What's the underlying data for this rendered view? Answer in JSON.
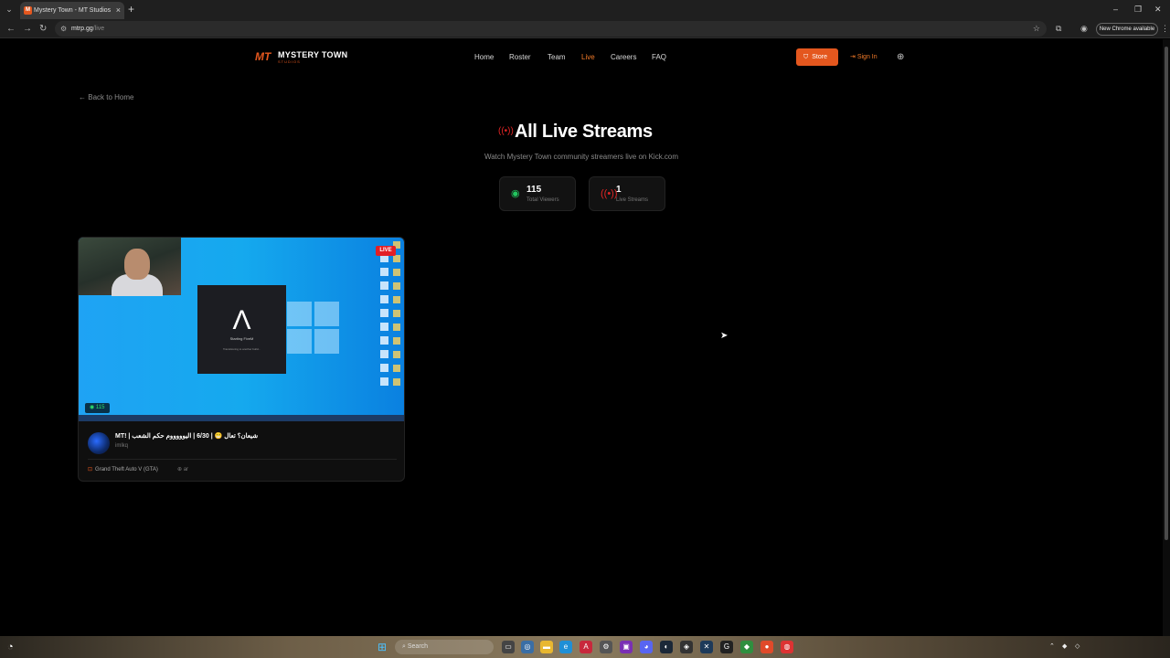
{
  "browser": {
    "tab_title": "Mystery Town - MT Studios | M",
    "favicon_text": "M",
    "url_host": "mtrp.gg",
    "url_path": "/live",
    "update_label": "New Chrome available"
  },
  "site": {
    "logo_mark": "MT",
    "logo_name": "MYSTERY TOWN",
    "logo_sub": "STUDIOS",
    "nav": [
      "Home",
      "Roster",
      "Team",
      "Live",
      "Careers",
      "FAQ"
    ],
    "active_nav": "Live",
    "store_label": "Store",
    "signin_label": "Sign In",
    "accent": "#e4571e"
  },
  "page": {
    "back_label": "Back to Home",
    "title": "All Live Streams",
    "subtitle": "Watch Mystery Town community streamers live on Kick.com",
    "stats": [
      {
        "value": "115",
        "label": "Total Viewers",
        "icon": "eye-icon",
        "color": "#22c55e"
      },
      {
        "value": "1",
        "label": "Live Streams",
        "icon": "broadcast-icon",
        "color": "#e02424"
      }
    ]
  },
  "stream": {
    "live_badge": "LIVE",
    "viewers": "115",
    "title": "شيعان؟ تعال 😁 | 6/30 | اليوووووم حكم الشعب | !MT",
    "username": "imlkq",
    "game": "Grand Theft Auto V (GTA)",
    "language": "ar",
    "thumb_dialog_title": "Starting FiveM",
    "thumb_dialog_text": "Transitioning to another build..."
  },
  "taskbar": {
    "search_placeholder": "Search"
  }
}
